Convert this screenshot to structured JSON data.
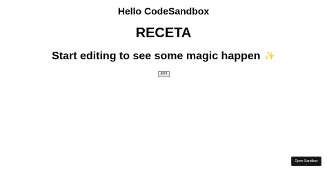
{
  "header": {
    "greeting": "Hello CodeSandbox",
    "title": "RECETA",
    "subtitle": "Start editing to see some magic happen",
    "subtitle_emoji": "✨"
  },
  "actions": {
    "print_label": "print"
  },
  "footer": {
    "open_sandbox_label": "Open Sandbox"
  }
}
